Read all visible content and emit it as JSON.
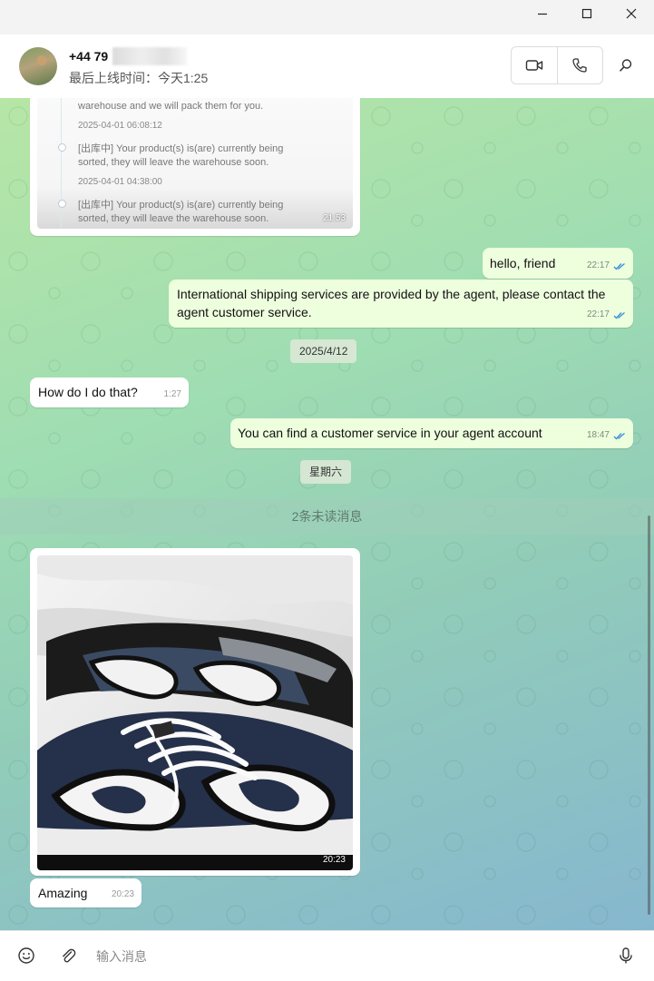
{
  "window": {
    "controls": [
      "minimize",
      "maximize",
      "close"
    ]
  },
  "header": {
    "name": "+44 79",
    "last_seen": "最后上线时间：今天1:25",
    "icons": [
      "video-call-icon",
      "voice-call-icon",
      "search-icon"
    ]
  },
  "old_card": {
    "line1": "warehouse and we will pack them for you.",
    "date1": "2025-04-01 06:08:12",
    "line2a": "[出库中] Your product(s) is(are) currently being",
    "line2b": "sorted, they will leave the warehouse soon.",
    "date2": "2025-04-01 04:38:00",
    "line3a": "[出库中] Your product(s) is(are) currently being",
    "line3b": "sorted, they will leave the warehouse soon.",
    "time": "21:53"
  },
  "messages": {
    "m1": {
      "text": "hello, friend",
      "time": "22:17"
    },
    "m2": {
      "text": "International shipping services are provided by the agent, please contact the agent customer service.",
      "time": "22:17"
    },
    "date_a": "2025/4/12",
    "m3": {
      "text": "How do I do that?",
      "time": "1:27"
    },
    "m4": {
      "text": "You can find a customer service in your agent account",
      "time": "18:47"
    },
    "date_b": "星期六",
    "unread": "2条未读消息",
    "photo_time": "20:23",
    "m5": {
      "text": "Amazing",
      "time": "20:23"
    }
  },
  "composer": {
    "placeholder": "输入消息",
    "icons": [
      "emoji-icon",
      "attach-icon",
      "microphone-icon"
    ]
  }
}
